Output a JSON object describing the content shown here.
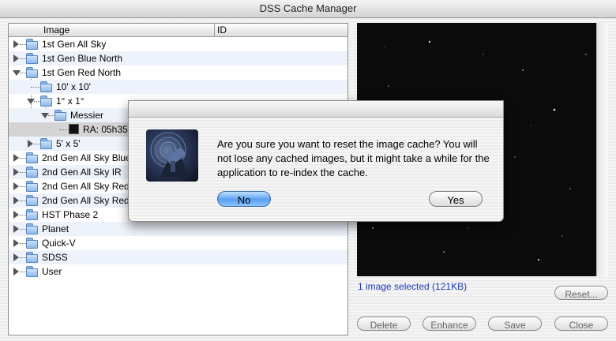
{
  "window": {
    "title": "DSS Cache Manager"
  },
  "tree": {
    "columns": {
      "image": "Image",
      "id": "ID"
    },
    "rows": [
      {
        "label": "1st Gen All Sky"
      },
      {
        "label": "1st Gen Blue North"
      },
      {
        "label": "1st Gen Red North"
      },
      {
        "label": "10' x 10'"
      },
      {
        "label": "1° x 1°"
      },
      {
        "label": "Messier"
      },
      {
        "label": "RA: 05h35"
      },
      {
        "label": "5' x 5'"
      },
      {
        "label": "2nd Gen All Sky Blue"
      },
      {
        "label": "2nd Gen All Sky IR"
      },
      {
        "label": "2nd Gen All Sky Red"
      },
      {
        "label": "2nd Gen All Sky Red-"
      },
      {
        "label": "HST Phase 2"
      },
      {
        "label": "Planet"
      },
      {
        "label": "Quick-V"
      },
      {
        "label": "SDSS"
      },
      {
        "label": "User"
      }
    ]
  },
  "preview": {
    "status": "1 image selected (121KB)"
  },
  "buttons": {
    "reset": "Reset...",
    "delete": "Delete",
    "enhance": "Enhance",
    "save": "Save",
    "close": "Close"
  },
  "dialog": {
    "message": "Are you sure you want to reset the image cache? You will not lose any cached images, but it might take a while for the application to re-index the cache.",
    "no_label": "No",
    "yes_label": "Yes"
  },
  "colors": {
    "status_text": "#1d3ab5",
    "default_button": "#5a9ff0",
    "preview_bg": "#0b0b0b"
  }
}
